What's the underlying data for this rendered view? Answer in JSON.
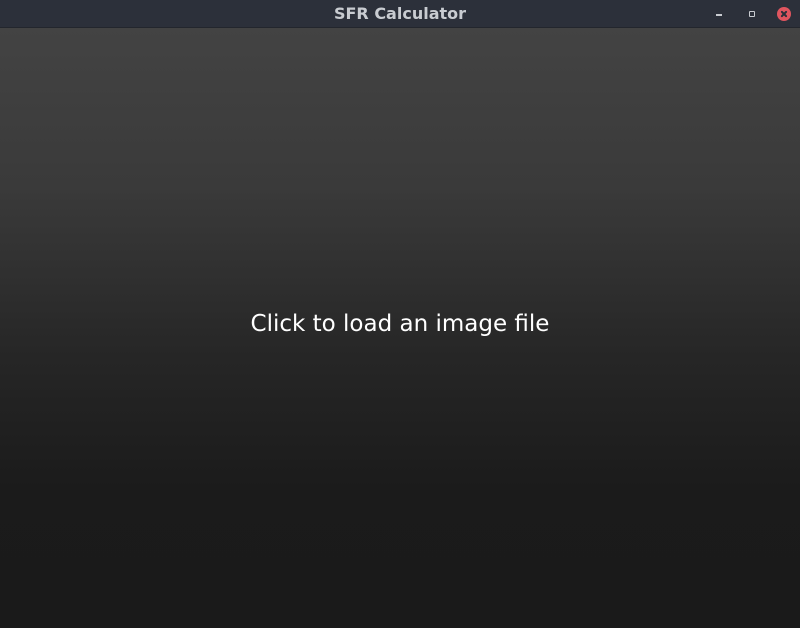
{
  "window": {
    "title": "SFR Calculator",
    "controls": {
      "minimize_icon": "minimize-icon",
      "maximize_icon": "maximize-icon",
      "close_icon": "close-icon",
      "close_color": "#e0555f"
    }
  },
  "main": {
    "prompt": "Click to load an image file"
  }
}
